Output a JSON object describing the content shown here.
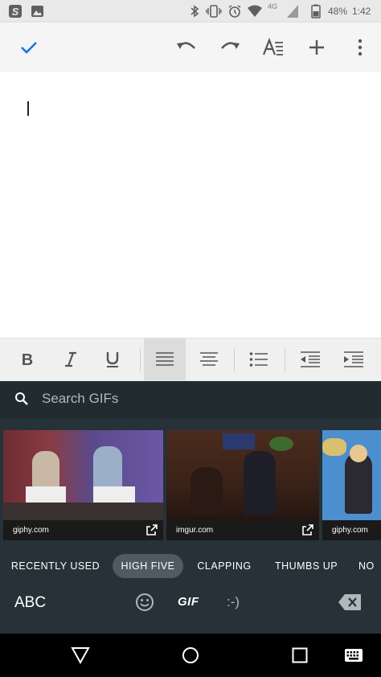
{
  "status_bar": {
    "network": "4G",
    "battery": "48%",
    "time": "1:42"
  },
  "document": {
    "body_text": ""
  },
  "keyboard": {
    "search_placeholder": "Search GIFs",
    "gifs": [
      {
        "source": "giphy.com"
      },
      {
        "source": "imgur.com"
      },
      {
        "source": "giphy.com"
      }
    ],
    "categories": [
      {
        "label": "RECENTLY USED"
      },
      {
        "label": "HIGH FIVE",
        "selected": true
      },
      {
        "label": "CLAPPING"
      },
      {
        "label": "THUMBS UP"
      },
      {
        "label": "NO"
      }
    ],
    "bottom_row": {
      "abc_label": "ABC",
      "gif_label": "GIF",
      "emoticon_label": ":-)"
    }
  },
  "colors": {
    "accent_blue": "#1a73e8",
    "keyboard_bg": "#263238",
    "chip_active": "#4f5b61"
  }
}
